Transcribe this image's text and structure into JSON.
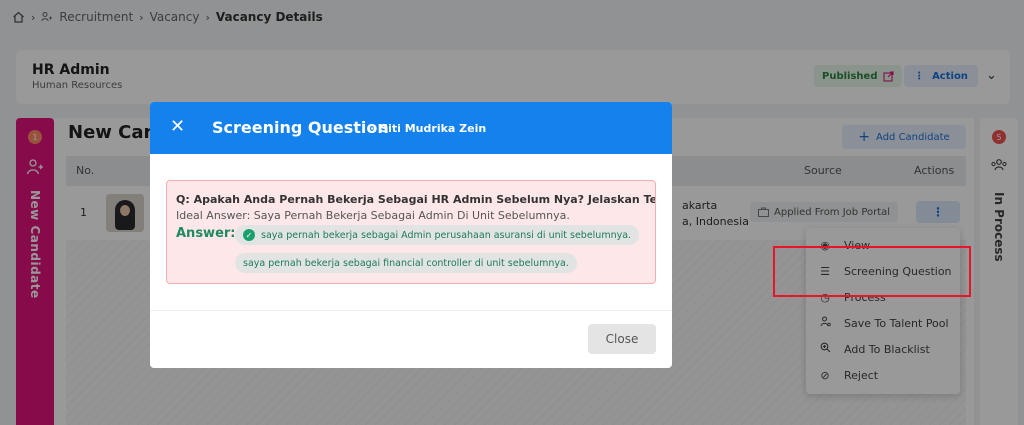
{
  "breadcrumb": {
    "home_icon": "home-icon",
    "recruitment": "Recruitment",
    "vacancy": "Vacancy",
    "current": "Vacancy Details",
    "sep": "›"
  },
  "header": {
    "title": "HR Admin",
    "subtitle": "Human Resources",
    "status": "Published",
    "action_label": "Action"
  },
  "stages": {
    "left": {
      "count": "1",
      "label": "New Candidate"
    },
    "right": {
      "count": "5",
      "label": "In Process"
    }
  },
  "panel": {
    "title": "New Can",
    "add_candidate": "Add Candidate",
    "columns": {
      "no": "No.",
      "source": "Source",
      "actions": "Actions"
    },
    "row": {
      "no": "1",
      "location_line1": "akarta",
      "location_line2": "a, Indonesia",
      "source": "Applied From Job Portal",
      "actions_icon": "⋮"
    }
  },
  "dropdown": {
    "items": [
      {
        "label": "View",
        "icon": "eye-icon"
      },
      {
        "label": "Screening Question",
        "icon": "list-icon"
      },
      {
        "label": "Process",
        "icon": "clock-icon"
      },
      {
        "label": "Save To Talent Pool",
        "icon": "person-icon"
      },
      {
        "label": "Add To Blacklist",
        "icon": "zoom-icon"
      },
      {
        "label": "Reject",
        "icon": "ban-icon"
      }
    ]
  },
  "modal": {
    "title": "Screening Question",
    "subtitle": "Siti Mudrika Zein",
    "question": "Q: Apakah Anda Pernah Bekerja Sebagai HR Admin Sebelum Nya? Jelaskan Terkait Job And",
    "ideal_answer": "Ideal Answer: Saya Pernah Bekerja Sebagai Admin Di Unit Sebelumnya.",
    "answer_label": "Answer:",
    "answers": [
      "saya pernah bekerja sebagai Admin perusahaan asuransi di unit sebelumnya.",
      "saya pernah bekerja sebagai financial controller di unit sebelumnya."
    ],
    "close_label": "Close"
  },
  "colors": {
    "primary": "#1481ed",
    "stage_new": "#e2127e",
    "answer_green": "#1e8a63",
    "highlight": "#e8142a"
  }
}
